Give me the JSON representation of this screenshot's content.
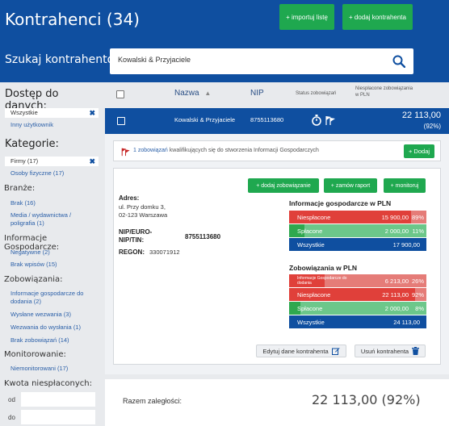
{
  "header": {
    "title": "Kontrahenci (34)",
    "import_button": "+ importuj listę",
    "add_button": "+ dodaj kontrahenta",
    "search_label": "Szukaj kontrahentów:",
    "search_value": "Kowalski & Przyjaciele"
  },
  "sidebar": {
    "access_title": "Dostęp do danych:",
    "access_selected": "Wszystkie",
    "access_other": "Inny użytkownik",
    "categories_title": "Kategorie:",
    "category_selected": "Firmy (17)",
    "category_other": "Osoby fizyczne (17)",
    "industry_title": "Branże:",
    "industry_items": [
      "Brak (16)",
      "Media / wydawnictwa /",
      "poligrafia (1)"
    ],
    "info_title": "Informacje Gospodarcze:",
    "info_items": [
      "Negatywne (2)",
      "Brak wpisów (15)"
    ],
    "liabilities_title": "Zobowiązania:",
    "liabilities_items": [
      "Informacje gospodarcze do",
      "dodania (2)",
      "Wysłane wezwania (3)",
      "Wezwania do wysłania (1)",
      "Brak zobowiązań (14)"
    ],
    "monitoring_title": "Monitorowanie:",
    "monitoring_items": [
      "Niemonitorowani (17)"
    ],
    "amount_title": "Kwota niespłaconych:",
    "from_label": "od",
    "to_label": "do"
  },
  "table": {
    "col_name": "Nazwa",
    "col_nip": "NIP",
    "col_status": "Status zobowiązań",
    "col_unpaid_line1": "Niespłacone zobowiązania",
    "col_unpaid_line2": "w PLN"
  },
  "selected_row": {
    "name": "Kowalski & Przyjaciele",
    "nip": "8755113680",
    "amount": "22 113,00",
    "percent": "(92%)"
  },
  "notice": {
    "text_link": "1 zobowiązań",
    "text_rest": "kwalifikujących się do stworzenia Informacji Gospodarczych",
    "add_button": "+ Dodaj"
  },
  "card": {
    "btn_add_liability": "+ dodaj zobowiązanie",
    "btn_order_report": "+ zamów raport",
    "btn_monitor": "+ monitoruj",
    "address_label": "Adres:",
    "address_line1": "ul. Przy domku 3,",
    "address_line2": "02-123 Warszawa",
    "nip_label_line1": "NIP/EURO-",
    "nip_label_line2": "NIP/TIN:",
    "nip_value": "8755113680",
    "regon_label": "REGON:",
    "regon_value": "330071912",
    "info_title": "Informacje gospodarcze w PLN",
    "info_rows": [
      {
        "label": "Niespłacone",
        "amount": "15 900,00",
        "percent": "89%",
        "fill": 0.89,
        "color": "#e0403a",
        "bg": "#e57c78"
      },
      {
        "label": "Spłacone",
        "amount": "2 000,00",
        "percent": "11%",
        "fill": 0.11,
        "color": "#2fa84f",
        "bg": "#6cc78a"
      },
      {
        "label": "Wszystkie",
        "amount": "17 900,00",
        "percent": "",
        "fill": 1,
        "color": "#0f4fa0",
        "bg": "#0f4fa0"
      }
    ],
    "liab_title": "Zobowiązania w PLN",
    "liab_rows": [
      {
        "label": "Informacje Gospodarcze do dodania",
        "amount": "6 213,00",
        "percent": "26%",
        "fill": 0.26,
        "color": "#e0403a",
        "bg": "#e57c78"
      },
      {
        "label": "Niespłacone",
        "amount": "22 113,00",
        "percent": "92%",
        "fill": 0.92,
        "color": "#e0403a",
        "bg": "#e57c78"
      },
      {
        "label": "Spłacone",
        "amount": "2 000,00",
        "percent": "8%",
        "fill": 0.08,
        "color": "#2fa84f",
        "bg": "#6cc78a"
      },
      {
        "label": "Wszystkie",
        "amount": "24 113,00",
        "percent": "",
        "fill": 1,
        "color": "#0f4fa0",
        "bg": "#0f4fa0"
      }
    ],
    "btn_edit": "Edytuj dane kontrahenta",
    "btn_delete": "Usuń kontrahenta"
  },
  "total": {
    "label": "Razem zaległości:",
    "value": "22 113,00 (92%)"
  },
  "icons": {
    "search": "search-icon",
    "stopwatch": "stopwatch-icon",
    "flags": "flags-icon",
    "edit": "edit-icon",
    "trash": "trash-icon"
  }
}
